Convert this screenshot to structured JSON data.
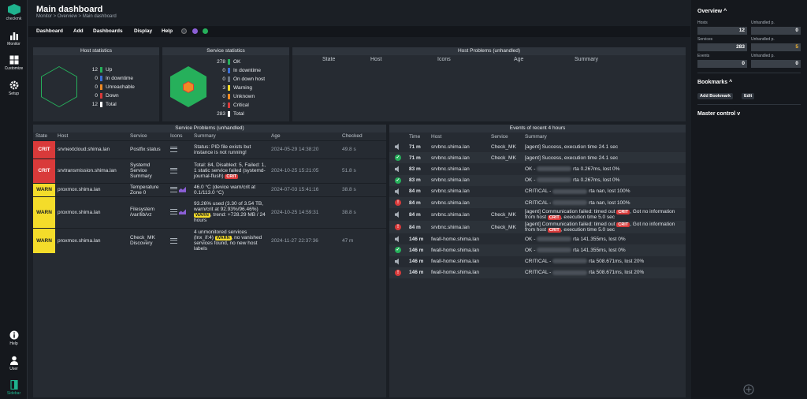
{
  "nav": {
    "brand": "checkmk",
    "items": [
      {
        "label": "Monitor"
      },
      {
        "label": "Customize"
      },
      {
        "label": "Setup"
      }
    ],
    "bottom": [
      {
        "label": "Help"
      },
      {
        "label": "User"
      },
      {
        "label": "Sidebar"
      }
    ]
  },
  "page": {
    "title": "Main dashboard",
    "breadcrumb": "Monitor > Overview > Main dashboard"
  },
  "menu": [
    "Dashboard",
    "Add",
    "Dashboards",
    "Display",
    "Help"
  ],
  "host_stats": {
    "title": "Host statistics",
    "rows": [
      {
        "n": "12",
        "label": "Up",
        "color": "#26b05b"
      },
      {
        "n": "0",
        "label": "In downtime",
        "color": "#3b6fd6"
      },
      {
        "n": "0",
        "label": "Unreachable",
        "color": "#f08a24"
      },
      {
        "n": "0",
        "label": "Down",
        "color": "#d93a3a"
      },
      {
        "n": "12",
        "label": "Total",
        "color": "#ffffff"
      }
    ]
  },
  "service_stats": {
    "title": "Service statistics",
    "rows": [
      {
        "n": "278",
        "label": "OK",
        "color": "#26b05b"
      },
      {
        "n": "0",
        "label": "In downtime",
        "color": "#3b6fd6"
      },
      {
        "n": "0",
        "label": "On down host",
        "color": "#6a7580"
      },
      {
        "n": "3",
        "label": "Warning",
        "color": "#f4dc2a"
      },
      {
        "n": "0",
        "label": "Unknown",
        "color": "#f08a24"
      },
      {
        "n": "2",
        "label": "Critical",
        "color": "#d93a3a"
      },
      {
        "n": "283",
        "label": "Total",
        "color": "#ffffff"
      }
    ]
  },
  "host_problems": {
    "title": "Host Problems (unhandled)",
    "cols": [
      "State",
      "Host",
      "Icons",
      "Age",
      "Summary"
    ]
  },
  "service_problems": {
    "title": "Service Problems (unhandled)",
    "cols": [
      "State",
      "Host",
      "Service",
      "Icons",
      "Summary",
      "Age",
      "Checked"
    ],
    "rows": [
      {
        "state": "CRIT",
        "host": "srvnextcloud.shima.lan",
        "service": "Postfix status",
        "summary": "Status: PID file exists but instance is not running!",
        "badge": "",
        "age": "2024-05-29 14:38:20",
        "checked": "49.8 s",
        "graph": false
      },
      {
        "state": "CRIT",
        "host": "srvtransmission.shima.lan",
        "service": "Systemd Service Summary",
        "summary": "Total: 84, Disabled: 5, Failed: 1, 1 static service failed (systemd-journal-flush)",
        "badge": "CRIT",
        "age": "2024-10-25 15:21:05",
        "checked": "51.8 s",
        "graph": false
      },
      {
        "state": "WARN",
        "host": "proxmox.shima.lan",
        "service": "Temperature Zone 0",
        "summary": "46.0 °C (device warn/crit at 0.1/113.0 °C)",
        "badge": "",
        "age": "2024-07-03 15:41:16",
        "checked": "38.8 s",
        "graph": true
      },
      {
        "state": "WARN",
        "host": "proxmox.shima.lan",
        "service": "Filesystem /var/lib/vz",
        "summary": "93.26% used (3.30 of 3.54 TB, warn/crit at 92.93%/96.46%)",
        "badge": "WARN",
        "summary_tail": ", trend: +728.29 MB / 24 hours",
        "age": "2024-10-25 14:59:31",
        "checked": "38.8 s",
        "graph": true
      },
      {
        "state": "WARN",
        "host": "proxmox.shima.lan",
        "service": "Check_MK Discovery",
        "summary": "4 unmonitored services (lnx_if:4)",
        "badge": "WARN",
        "summary_tail": ", no vanished services found, no new host labels",
        "age": "2024-11-27 22:37:36",
        "checked": "47 m",
        "graph": false
      }
    ]
  },
  "events": {
    "title": "Events of recent 4 hours",
    "cols": [
      "Time",
      "Host",
      "Service",
      "Summary"
    ],
    "rows": [
      {
        "icon": "sound",
        "time": "71 m",
        "host": "srvbnc.shima.lan",
        "service": "Check_MK",
        "pre": "[agent] Success, execution time 24.1 sec",
        "badge": "",
        "post": "",
        "blur": false
      },
      {
        "icon": "ok",
        "time": "71 m",
        "host": "srvbnc.shima.lan",
        "service": "Check_MK",
        "pre": "[agent] Success, execution time 24.1 sec",
        "badge": "",
        "post": "",
        "blur": false
      },
      {
        "icon": "sound",
        "time": "83 m",
        "host": "srvbnc.shima.lan",
        "service": "",
        "pre": "OK - ",
        "badge": "",
        "post": "rta 0.267ms, lost 0%",
        "blur": true
      },
      {
        "icon": "ok",
        "time": "83 m",
        "host": "srvbnc.shima.lan",
        "service": "",
        "pre": "OK - ",
        "badge": "",
        "post": "rta 0.267ms, lost 0%",
        "blur": true
      },
      {
        "icon": "sound",
        "time": "84 m",
        "host": "srvbnc.shima.lan",
        "service": "",
        "pre": "CRITICAL - ",
        "badge": "",
        "post": "rta nan, lost 100%",
        "blur": true
      },
      {
        "icon": "err",
        "time": "84 m",
        "host": "srvbnc.shima.lan",
        "service": "",
        "pre": "CRITICAL - ",
        "badge": "",
        "post": "rta nan, lost 100%",
        "blur": true
      },
      {
        "icon": "sound",
        "time": "84 m",
        "host": "srvbnc.shima.lan",
        "service": "Check_MK",
        "pre": "[agent] Communication failed: timed out ",
        "badge": "CRIT",
        "post": ", Got no information from host ",
        "badge2": "CRIT",
        "post2": ", execution time 5.0 sec",
        "blur": false
      },
      {
        "icon": "err",
        "time": "84 m",
        "host": "srvbnc.shima.lan",
        "service": "Check_MK",
        "pre": "[agent] Communication failed: timed out ",
        "badge": "CRIT",
        "post": ", Got no information from host ",
        "badge2": "CRIT",
        "post2": ", execution time 5.0 sec",
        "blur": false
      },
      {
        "icon": "sound",
        "time": "146 m",
        "host": "fwall-home.shima.lan",
        "service": "",
        "pre": "OK - ",
        "badge": "",
        "post": "rta 141.355ms, lost 0%",
        "blur": true
      },
      {
        "icon": "ok",
        "time": "146 m",
        "host": "fwall-home.shima.lan",
        "service": "",
        "pre": "OK - ",
        "badge": "",
        "post": "rta 141.355ms, lost 0%",
        "blur": true
      },
      {
        "icon": "sound",
        "time": "146 m",
        "host": "fwall-home.shima.lan",
        "service": "",
        "pre": "CRITICAL - ",
        "badge": "",
        "post": "rta 508.671ms, lost 20%",
        "blur": true
      },
      {
        "icon": "err",
        "time": "146 m",
        "host": "fwall-home.shima.lan",
        "service": "",
        "pre": "CRITICAL - ",
        "badge": "",
        "post": "rta 508.671ms, lost 20%",
        "blur": true
      }
    ]
  },
  "sidebar": {
    "overview_title": "Overview",
    "hosts_label": "Hosts",
    "hosts": "12",
    "hosts_unh_label": "Unhandled p.",
    "hosts_unh": "0",
    "services_label": "Services",
    "services": "283",
    "services_unh_label": "Unhandled p.",
    "services_unh": "5",
    "events_label": "Events",
    "events": "0",
    "events_unh_label": "Unhandled p.",
    "events_unh": "0",
    "bookmarks_title": "Bookmarks",
    "add_bookmark": "Add Bookmark",
    "edit": "Edit",
    "master_control": "Master control"
  }
}
